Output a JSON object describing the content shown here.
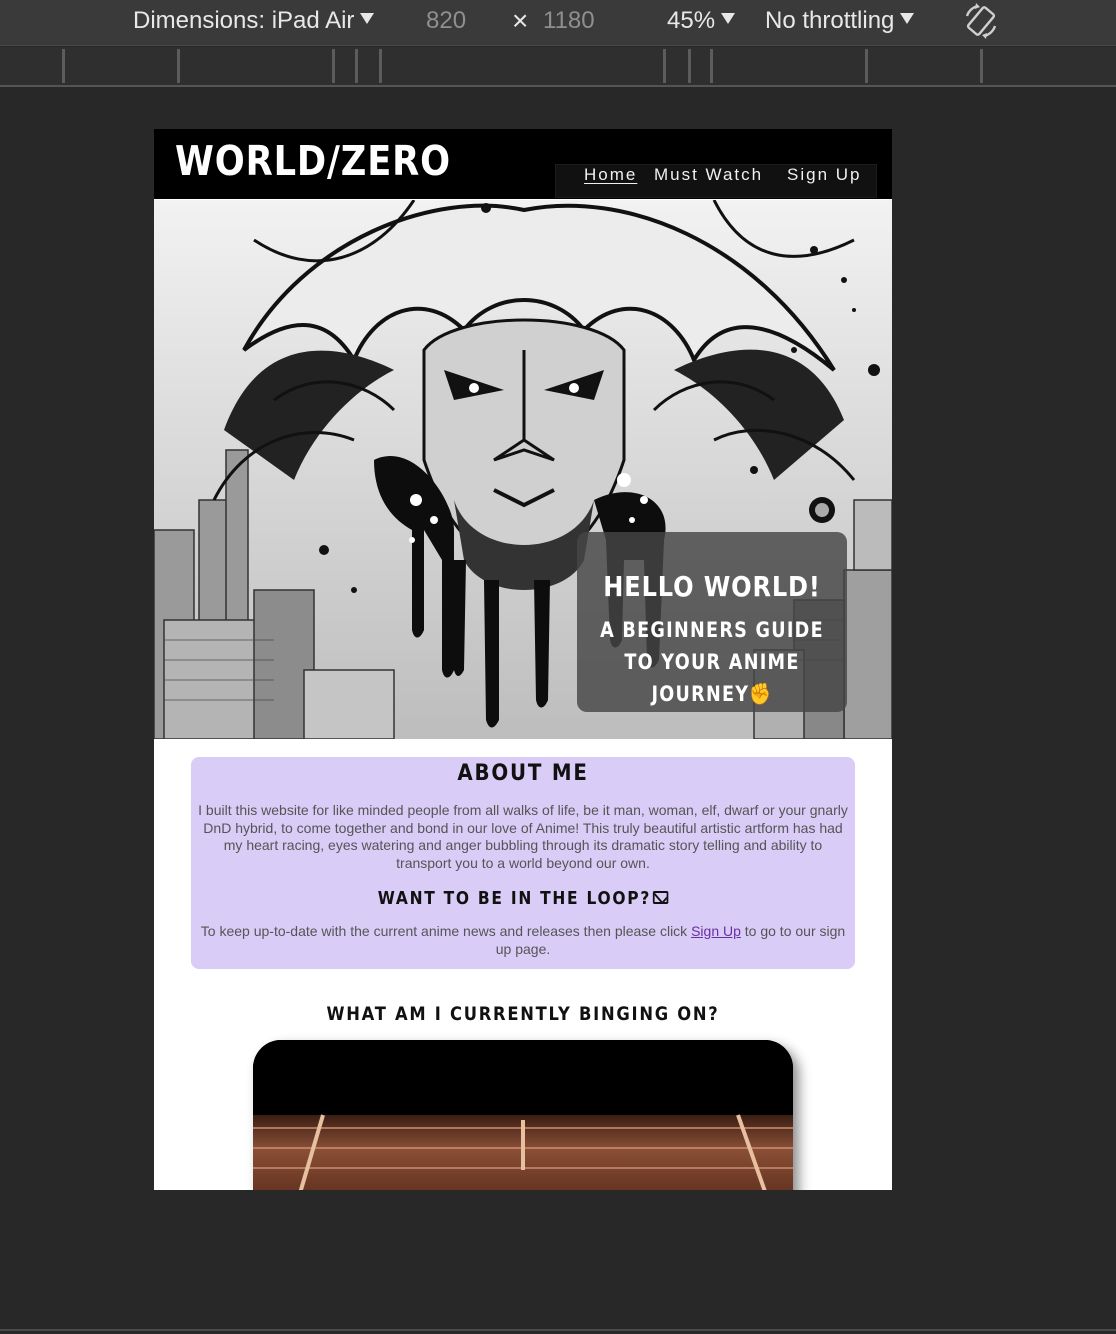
{
  "devtools": {
    "device_label": "Dimensions: iPad Air",
    "width_value": "820",
    "times_symbol": "×",
    "height_value": "1180",
    "zoom_label": "45%",
    "throttle_label": "No throttling",
    "rotate_icon": "rotate-icon"
  },
  "site": {
    "logo": "WORLD/ZERO",
    "nav": {
      "home": "Home",
      "must_watch": "Must Watch",
      "sign_up": "Sign Up"
    },
    "hero": {
      "title": "HELLO WORLD!",
      "subtitle": "A BEGINNERS GUIDE TO YOUR ANIME JOURNEY",
      "emoji": "✊"
    },
    "about": {
      "heading": "ABOUT ME",
      "body": "I built this website for like minded people from all walks of life, be it man, woman, elf, dwarf or your gnarly DnD hybrid, to come together and bond in our love of Anime! This truly beautiful artistic artform has had my heart racing, eyes watering and anger bubbling through its dramatic story telling and ability to transport you to a world beyond our own.",
      "loop_heading": "WANT TO BE IN THE LOOP?",
      "loop_text_before": "To keep up-to-date with the current anime news and releases then please click ",
      "loop_link": "Sign Up",
      "loop_text_after": " to go to our sign up page."
    },
    "binging_heading": "WHAT AM I CURRENTLY BINGING ON?"
  },
  "colors": {
    "header_bg": "#000000",
    "about_bg": "#d9ccf7",
    "link": "#6a2fa3",
    "devtools_bg": "#282828"
  }
}
